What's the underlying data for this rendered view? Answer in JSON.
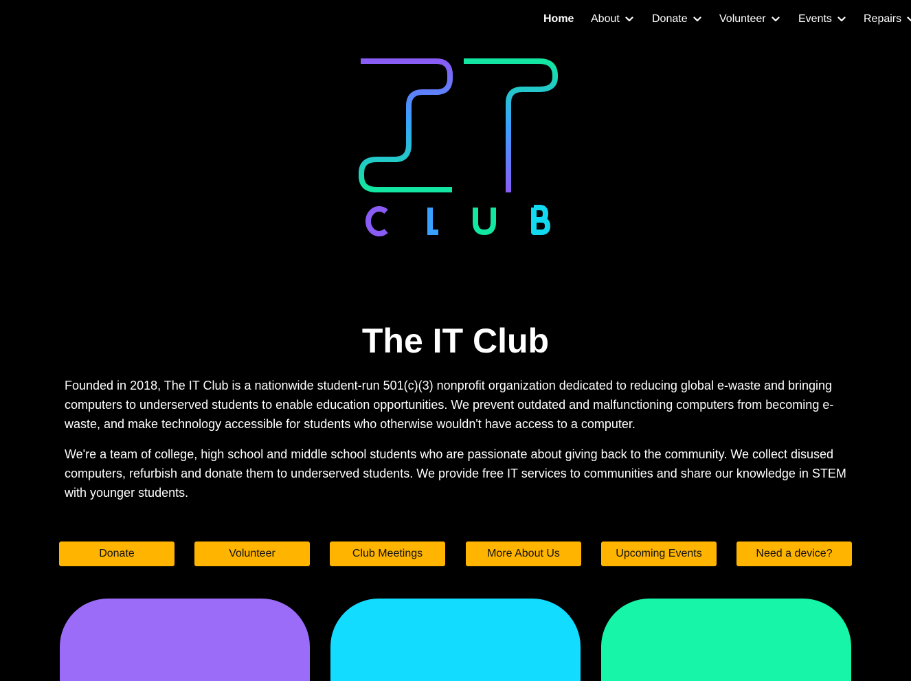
{
  "nav": {
    "items": [
      {
        "label": "Home",
        "active": true,
        "dropdown": false
      },
      {
        "label": "About",
        "active": false,
        "dropdown": true
      },
      {
        "label": "Donate",
        "active": false,
        "dropdown": true
      },
      {
        "label": "Volunteer",
        "active": false,
        "dropdown": true
      },
      {
        "label": "Events",
        "active": false,
        "dropdown": true
      },
      {
        "label": "Repairs",
        "active": false,
        "dropdown": true
      }
    ]
  },
  "logo": {
    "letters": [
      "C",
      "L",
      "U",
      "B"
    ],
    "colors": {
      "purple": "#8a5cf6",
      "blue": "#3aa0ff",
      "green": "#12e6a0",
      "cyan": "#12d8f0"
    }
  },
  "hero": {
    "title": "The IT Club",
    "paragraph1": "Founded in 2018, The IT Club is a nationwide student-run 501(c)(3) nonprofit organization dedicated to reducing global e-waste and bringing computers to underserved students to enable education opportunities. We prevent outdated and malfunctioning computers from becoming e-waste, and make technology accessible for students who otherwise wouldn't have access to a computer.",
    "paragraph2": "We're a team of college, high school and middle school students who are passionate about giving back to the community. We collect disused computers, refurbish and donate them to underserved students. We provide free IT services to communities and share our knowledge in STEM with younger students."
  },
  "buttons": {
    "donate": "Donate",
    "volunteer": "Volunteer",
    "club_meetings": "Club Meetings",
    "more_about_us": "More About Us",
    "upcoming_events": "Upcoming Events",
    "need_device": "Need a device?",
    "color": "#ffb400"
  },
  "cards": {
    "colors": [
      "#9b6cf7",
      "#12dcff",
      "#17f5a8"
    ]
  }
}
